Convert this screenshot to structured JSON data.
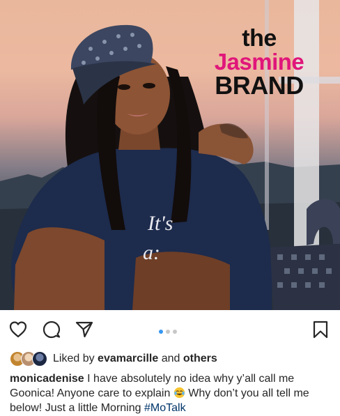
{
  "watermark": {
    "line1": "the",
    "line2": "Jasmine",
    "line3": "BRAND"
  },
  "photo": {
    "shirt_text_1": "It's",
    "shirt_text_2": "a:"
  },
  "actions": {
    "like_icon": "heart-outline-icon",
    "comment_icon": "comment-icon",
    "share_icon": "paper-plane-icon",
    "save_icon": "bookmark-icon",
    "carousel_count": 3,
    "carousel_active": 1
  },
  "likes": {
    "prefix": "Liked by",
    "user": "evamarcille",
    "joiner": "and",
    "others": "others"
  },
  "caption": {
    "username": "monicadenise",
    "text_part1": "I have absolutely no idea why y’all call me Goonica! Anyone care to explain",
    "emoji": "tears-of-joy-emoji",
    "text_part2": "Why don’t you all tell me below! Just a little Morning",
    "hashtag": "#MoTalk"
  },
  "colors": {
    "brand_pink": "#e0167a",
    "link_blue": "#003569",
    "carousel_active": "#3897f0",
    "text": "#262626"
  }
}
